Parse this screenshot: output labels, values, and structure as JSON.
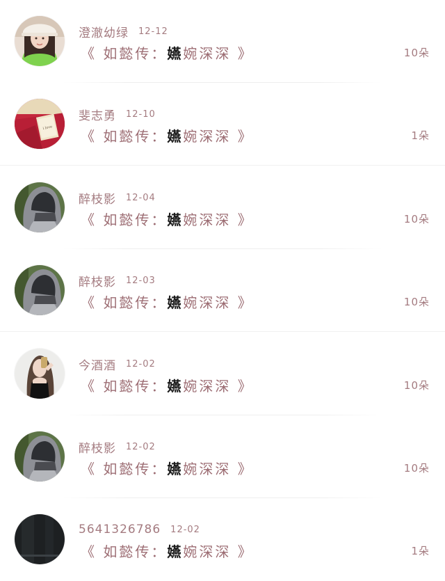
{
  "comments": [
    {
      "avatar": "avatar-girl-hat",
      "name": "澄澈幼绿",
      "date": "12-12",
      "gift_prefix": "《 如懿传：",
      "gift_dark": "嬿",
      "gift_suffix": "婉深深 》",
      "count": "10朵"
    },
    {
      "avatar": "avatar-red-book",
      "name": "斐志勇",
      "date": "12-10",
      "gift_prefix": "《 如懿传：",
      "gift_dark": "嬿",
      "gift_suffix": "婉深深 》",
      "count": "1朵"
    },
    {
      "avatar": "avatar-hooded",
      "name": "醉枝影",
      "date": "12-04",
      "gift_prefix": "《 如懿传：",
      "gift_dark": "嬿",
      "gift_suffix": "婉深深 》",
      "count": "10朵"
    },
    {
      "avatar": "avatar-hooded",
      "name": "醉枝影",
      "date": "12-03",
      "gift_prefix": "《 如懿传：",
      "gift_dark": "嬿",
      "gift_suffix": "婉深深 》",
      "count": "10朵"
    },
    {
      "avatar": "avatar-girl-selfie",
      "name": "今酒酒",
      "date": "12-02",
      "gift_prefix": "《 如懿传：",
      "gift_dark": "嬿",
      "gift_suffix": "婉深深 》",
      "count": "10朵"
    },
    {
      "avatar": "avatar-hooded",
      "name": "醉枝影",
      "date": "12-02",
      "gift_prefix": "《 如懿传：",
      "gift_dark": "嬿",
      "gift_suffix": "婉深深 》",
      "count": "10朵"
    },
    {
      "avatar": "avatar-dark",
      "name": "5641326786",
      "date": "12-02",
      "gift_prefix": "《 如懿传：",
      "gift_dark": "嬿",
      "gift_suffix": "婉深深 》",
      "count": "1朵"
    }
  ],
  "colors": {
    "text_accent": "#a47b80",
    "text_dark": "#1a1a1a",
    "background": "#ffffff"
  }
}
